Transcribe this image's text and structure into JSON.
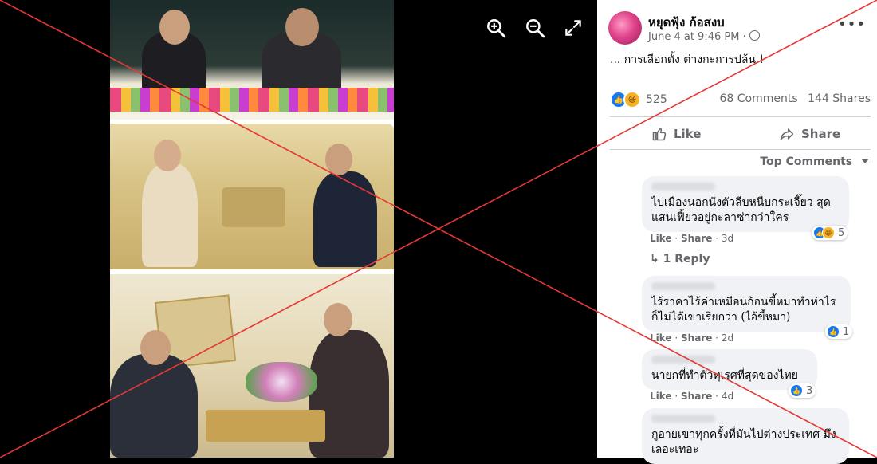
{
  "viewer": {
    "tools": [
      {
        "icon": "zoom-in-icon"
      },
      {
        "icon": "zoom-out-icon"
      },
      {
        "icon": "fullscreen-icon"
      }
    ],
    "overlay_color": "#e53935"
  },
  "post": {
    "author": "หยุดฟุ้ง ก้อสงบ",
    "date": "June 4 at 9:46 PM",
    "privacy_icon": "globe-icon",
    "more_label": "•••",
    "text": "... การเลือกตั้ง ต่างกะการปล้น !",
    "reaction_count": "525",
    "comments_count": "68 Comments",
    "shares_count": "144 Shares",
    "like_label": "Like",
    "share_label": "Share",
    "top_comments_label": "Top Comments"
  },
  "comments": [
    {
      "text": "ไปเมืองนอกนั่งตัวลีบหนีบกระเจี๊ยว สุดแสนเฟี้ยวอยู่กะลาซ่ากว่าใคร",
      "like": "Like",
      "share": "Share",
      "time": "3d",
      "reactions": "5",
      "reply": "1 Reply"
    },
    {
      "text": "ไร้ราคาไร้ค่าเหมือนก้อนขี้หมาทำห่าไรก็ไม่ได้เขาเรียกว่า (ไอ้ขี้หมา)",
      "like": "Like",
      "share": "Share",
      "time": "2d",
      "reactions": "1"
    },
    {
      "text": "นายกที่ทำตัวทุเรศที่สุดของไทย",
      "like": "Like",
      "share": "Share",
      "time": "4d",
      "reactions": "3"
    },
    {
      "text": "กูอายเขาทุกครั้งที่มันไปต่างประเทศ มึงเลอะเทอะ"
    }
  ]
}
